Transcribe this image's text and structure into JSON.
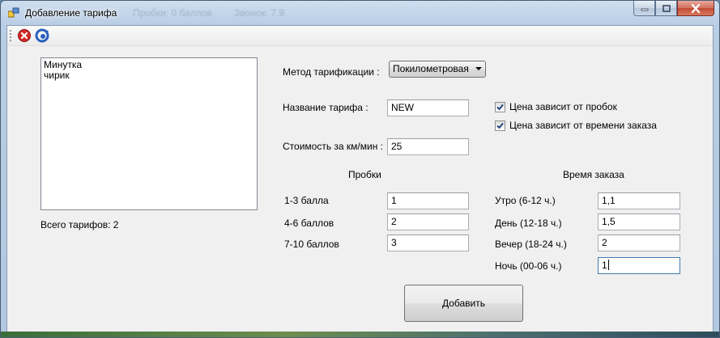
{
  "window": {
    "title": "Добавление тарифа",
    "ghost_tabs": [
      "Пробки: 0 баллов",
      "Звонок: 7.9"
    ]
  },
  "toolbar": {
    "items": [
      {
        "icon": "close-circle-icon",
        "color": "#d42a2a"
      },
      {
        "icon": "refresh-icon",
        "color": "#2a5fbf"
      }
    ]
  },
  "tariffs": {
    "items": [
      "Минутка",
      "чирик"
    ],
    "total_label": "Всего тарифов: 2"
  },
  "form": {
    "method_label": "Метод тарификации :",
    "method_value": "Покилометровая",
    "name_label": "Название тарифа :",
    "name_value": "NEW",
    "cost_label": "Стоимость за км/мин :",
    "cost_value": "25",
    "traffic_checkbox": "Цена зависит от пробок",
    "time_checkbox": "Цена зависит от времени заказа"
  },
  "traffic": {
    "header": "Пробки",
    "rows": [
      {
        "label": "1-3 балла",
        "value": "1"
      },
      {
        "label": "4-6 баллов",
        "value": "2"
      },
      {
        "label": "7-10 баллов",
        "value": "3"
      }
    ]
  },
  "order_time": {
    "header": "Время заказа",
    "rows": [
      {
        "label": "Утро (6-12 ч.)",
        "value": "1,1"
      },
      {
        "label": "День (12-18 ч.)",
        "value": "1,5"
      },
      {
        "label": "Вечер (18-24 ч.)",
        "value": "2"
      },
      {
        "label": "Ночь (00-06 ч.)",
        "value": "1"
      }
    ]
  },
  "actions": {
    "add_label": "Добавить"
  },
  "colors": {
    "accent": "#3d7bad",
    "check": "#1a3b7a"
  }
}
